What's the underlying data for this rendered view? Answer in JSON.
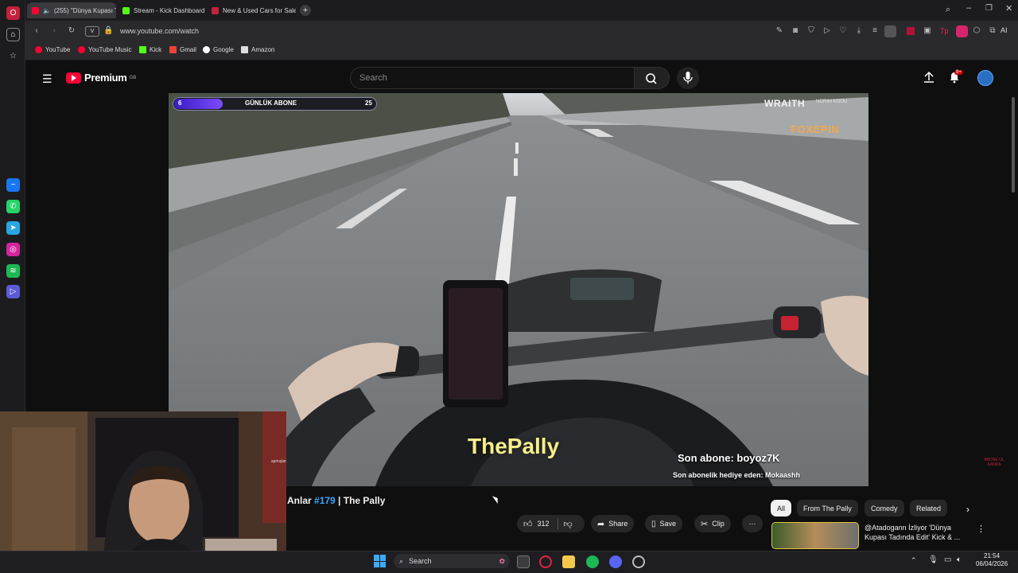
{
  "browser": {
    "tabs": [
      {
        "label": "(255) \"Dünya Kupası T",
        "active": true
      },
      {
        "label": "Stream - Kick Dashboard",
        "active": false
      },
      {
        "label": "New & Used Cars for Sale",
        "active": false
      }
    ],
    "url": "www.youtube.com/watch",
    "url_badge": "V",
    "toolbar_ai": "AI",
    "bookmarks": [
      "YouTube",
      "YouTube Music",
      "Kick",
      "Gmail",
      "Google",
      "Amazon"
    ]
  },
  "youtube": {
    "logo": "Premium",
    "logo_sup": "GB",
    "search_placeholder": "Search",
    "notifications_badge": "9+",
    "video": {
      "overlay_left_num": "6",
      "overlay_bar_label": "GÜNLÜK ABONE",
      "overlay_right_num": "25",
      "brand_1": "WRAITH",
      "brand_1_sub": "NORIM KOOU",
      "brand_2": "FOXEPIN",
      "watermark": "ThePally",
      "sub_line_1": "Son abone: boyoz7K",
      "sub_line_2": "Son abonelik hediye eden: Mokaashh",
      "side_text": "ABONE OL KANKA"
    },
    "title_prefix": "Anlar ",
    "title_hashtag": "#179",
    "title_suffix": " | The Pally",
    "actions": {
      "likes": "312",
      "share": "Share",
      "save": "Save",
      "clip": "Clip"
    },
    "chips": [
      "All",
      "From The Pally",
      "Comedy",
      "Related"
    ],
    "recommended_title_1": "@Atadogann İzliyor 'Dünya",
    "recommended_title_2": "Kupası Tadında Edit' Kick & ..."
  },
  "webcam": {
    "label": "apmışlar"
  },
  "taskbar": {
    "search": "Search",
    "time": "21:54",
    "date": "06/04/2026"
  },
  "colors": {
    "accent_red": "#ff0033",
    "kick_green": "#53fc18"
  }
}
